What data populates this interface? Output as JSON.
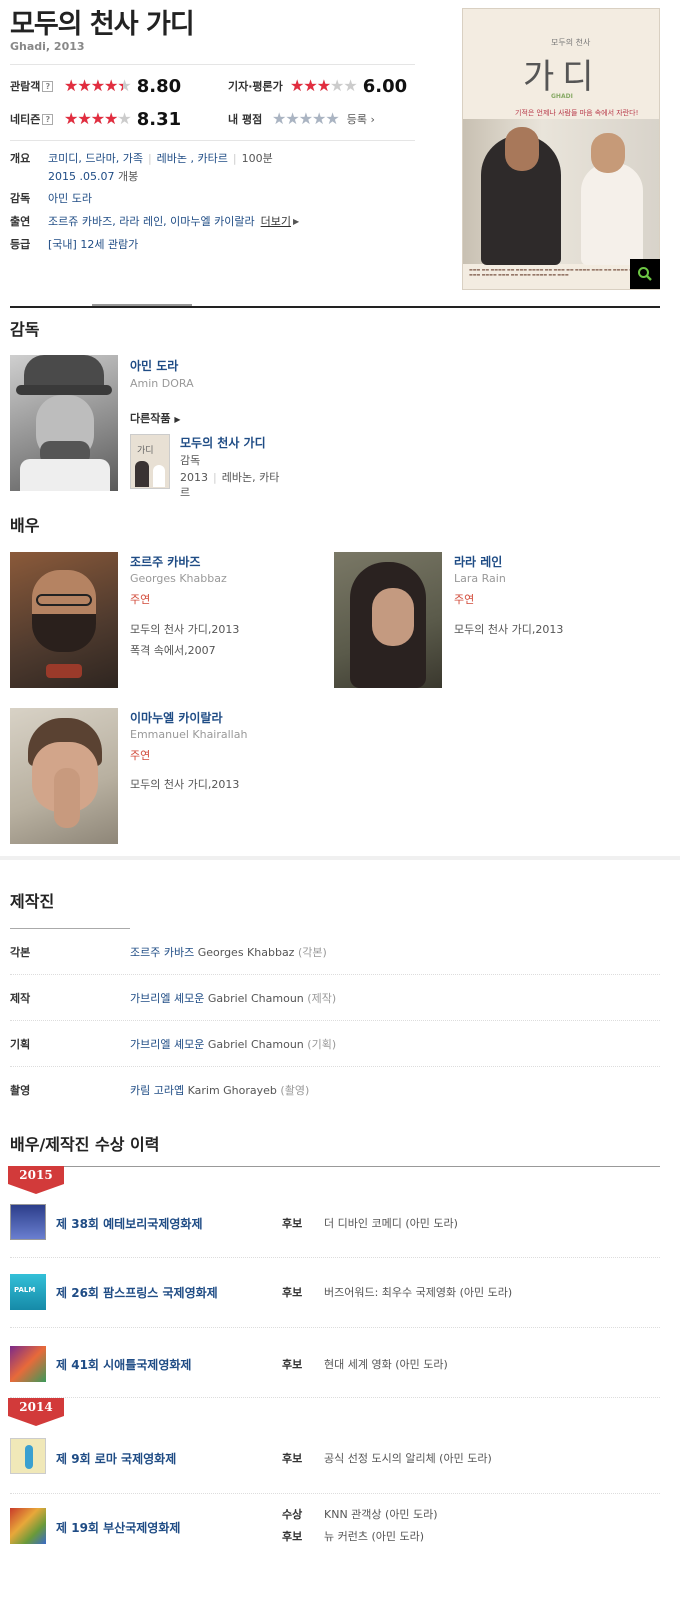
{
  "movie": {
    "title": "모두의 천사 가디",
    "subtitle": "Ghadi, 2013"
  },
  "ratings": {
    "audience": {
      "label": "관람객",
      "help": "?",
      "score": "8.80",
      "fraction": 0.88
    },
    "critics": {
      "label": "기자·평론가",
      "score": "6.00",
      "fraction": 0.6
    },
    "netizen": {
      "label": "네티즌",
      "help": "?",
      "score": "8.31",
      "fraction": 0.831
    },
    "my": {
      "label": "내 평점",
      "link": "등록",
      "fraction": 1.0
    },
    "star_color": "#e22d3f"
  },
  "info": {
    "overview_label": "개요",
    "genres": "코미디, 드라마, 가족",
    "countries": "레바논 , 카타르",
    "runtime": "100분",
    "release": "2015 .05.07",
    "release_suffix": "개봉",
    "director_label": "감독",
    "director": "아민 도라",
    "cast_label": "출연",
    "cast": "조르쥬 카바즈, 라라 레인, 이마누엘 카이랄라",
    "more": "더보기",
    "rating_label": "등급",
    "rating": "[국내] 12세 관람가"
  },
  "poster": {
    "title": "가디",
    "small": "모두의 천사",
    "en": "GHADI",
    "tagline": "기적은 언제나 사람들 마음 속에서 자란다!",
    "zoom_icon": "search-icon"
  },
  "director_section": {
    "heading": "감독",
    "name": "아민 도라",
    "en": "Amin DORA",
    "other_label": "다른작품",
    "other_title": "모두의 천사 가디",
    "other_role": "감독",
    "other_year": "2013",
    "other_country": "레바논, 카타",
    "other_country_wrap": "르"
  },
  "actors_section": {
    "heading": "배우",
    "actors": [
      {
        "name": "조르주 카바즈",
        "en": "Georges Khabbaz",
        "role": "주연",
        "works": [
          "모두의 천사 가디,2013",
          "폭격 속에서,2007"
        ]
      },
      {
        "name": "라라 레인",
        "en": "Lara Rain",
        "role": "주연",
        "works": [
          "모두의 천사 가디,2013"
        ]
      },
      {
        "name": "이마누엘 카이랄라",
        "en": "Emmanuel Khairallah",
        "role": "주연",
        "works": [
          "모두의 천사 가디,2013"
        ]
      }
    ]
  },
  "staff_section": {
    "heading": "제작진",
    "rows": [
      {
        "key": "각본",
        "name": "조르주 카바즈",
        "en": "Georges Khabbaz",
        "role": "(각본)"
      },
      {
        "key": "제작",
        "name": "가브리엘 셰모운",
        "en": "Gabriel Chamoun",
        "role": "(제작)"
      },
      {
        "key": "기획",
        "name": "가브리엘 셰모운",
        "en": "Gabriel Chamoun",
        "role": "(기획)"
      },
      {
        "key": "촬영",
        "name": "카림 고라옙",
        "en": "Karim Ghorayeb",
        "role": "(촬영)"
      }
    ]
  },
  "awards_section": {
    "heading": "배우/제작진 수상 이력",
    "years": [
      {
        "year": "2015",
        "items": [
          {
            "festival": "제 38회 예테보리국제영화제",
            "entries": [
              {
                "kind": "후보",
                "detail": "더 디바인 코메디 (아민 도라)"
              }
            ]
          },
          {
            "festival": "제 26회 팜스프링스 국제영화제",
            "entries": [
              {
                "kind": "후보",
                "detail": "버즈어워드: 최우수 국제영화 (아민 도라)"
              }
            ]
          },
          {
            "festival": "제 41회 시애틀국제영화제",
            "entries": [
              {
                "kind": "후보",
                "detail": "현대 세계 영화 (아민 도라)"
              }
            ]
          }
        ]
      },
      {
        "year": "2014",
        "items": [
          {
            "festival": "제 9회 로마 국제영화제",
            "entries": [
              {
                "kind": "후보",
                "detail": "공식 선정 도시의 알리체 (아민 도라)"
              }
            ]
          },
          {
            "festival": "제 19회 부산국제영화제",
            "entries": [
              {
                "kind": "수상",
                "detail": "KNN 관객상 (아민 도라)"
              },
              {
                "kind": "후보",
                "detail": "뉴 커런츠 (아민 도라)"
              }
            ]
          }
        ]
      }
    ],
    "flag_color": "#d23a3a"
  }
}
